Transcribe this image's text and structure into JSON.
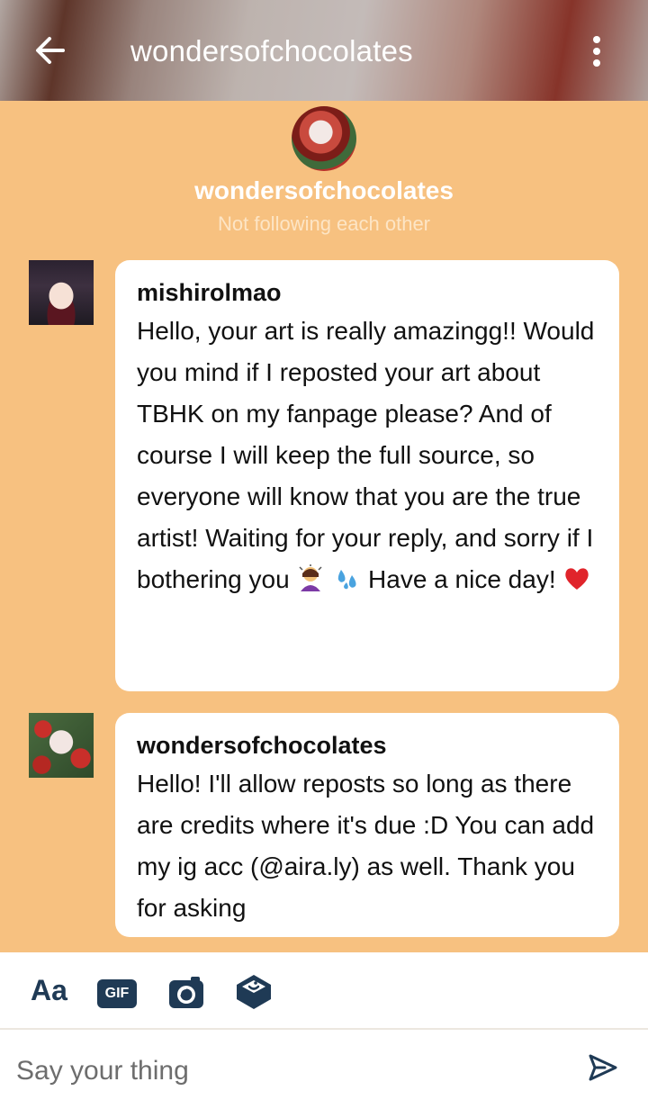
{
  "header": {
    "title": "wondersofchocolates",
    "back_icon": "arrow-left-icon",
    "more_icon": "more-vertical-icon"
  },
  "profile": {
    "name": "wondersofchocolates",
    "status": "Not following each other"
  },
  "messages": [
    {
      "sender": "mishirolmao",
      "text_before_emoji": "Hello, your art is really amazingg!! Would you mind if I reposted your art about TBHK on my fanpage please? And of course I will keep the full source, so everyone will know that you are the true artist! Waiting for your reply, and sorry if I bothering you",
      "emojis_1": [
        "person-bowing-emoji",
        "sweat-droplets-emoji"
      ],
      "text_middle": "Have a nice day!",
      "emoji_end": "red-heart-emoji"
    },
    {
      "sender": "wondersofchocolates",
      "text": "Hello! I'll allow reposts so long as there are credits where it's due :D You can add my ig acc (@aira.ly) as well. Thank you for asking"
    }
  ],
  "composer": {
    "text_format_label": "Aa",
    "gif_label": "GIF",
    "camera_icon": "camera-icon",
    "sticker_icon": "sticker-icon",
    "placeholder": "Say your thing",
    "send_icon": "send-icon"
  },
  "colors": {
    "background": "#f7c180",
    "bubble": "#ffffff",
    "toolbar_icons": "#1f3a55"
  }
}
